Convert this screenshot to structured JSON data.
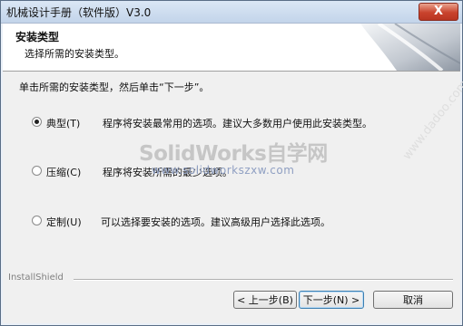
{
  "window": {
    "title": "机械设计手册（软件版）V3.0",
    "close_label": "X"
  },
  "header": {
    "title": "安装类型",
    "subtitle": "选择所需的安装类型。"
  },
  "instruction": "单击所需的安装类型，然后单击“下一步”。",
  "options": [
    {
      "label": "典型(T)",
      "description": "程序将安装最常用的选项。建议大多数用户使用此安装类型。",
      "selected": true
    },
    {
      "label": "压缩(C)",
      "description": "程序将安装所需的最少选项。",
      "selected": false
    },
    {
      "label": "定制(U)",
      "description": "可以选择要安装的选项。建议高级用户选择此选项。",
      "selected": false
    }
  ],
  "watermark": {
    "main": "SolidWorks自学网",
    "url": "www.solidworkszxw.com",
    "diagonal": "www.dadoo.com"
  },
  "footer": {
    "brand": "InstallShield"
  },
  "buttons": {
    "back": "< 上一步(B)",
    "next": "下一步(N) >",
    "cancel": "取消"
  },
  "colors": {
    "title_bar": "#c3d4ea",
    "close_button": "#c9432d",
    "panel": "#f0f0f0",
    "header_bg": "#ffffff"
  }
}
